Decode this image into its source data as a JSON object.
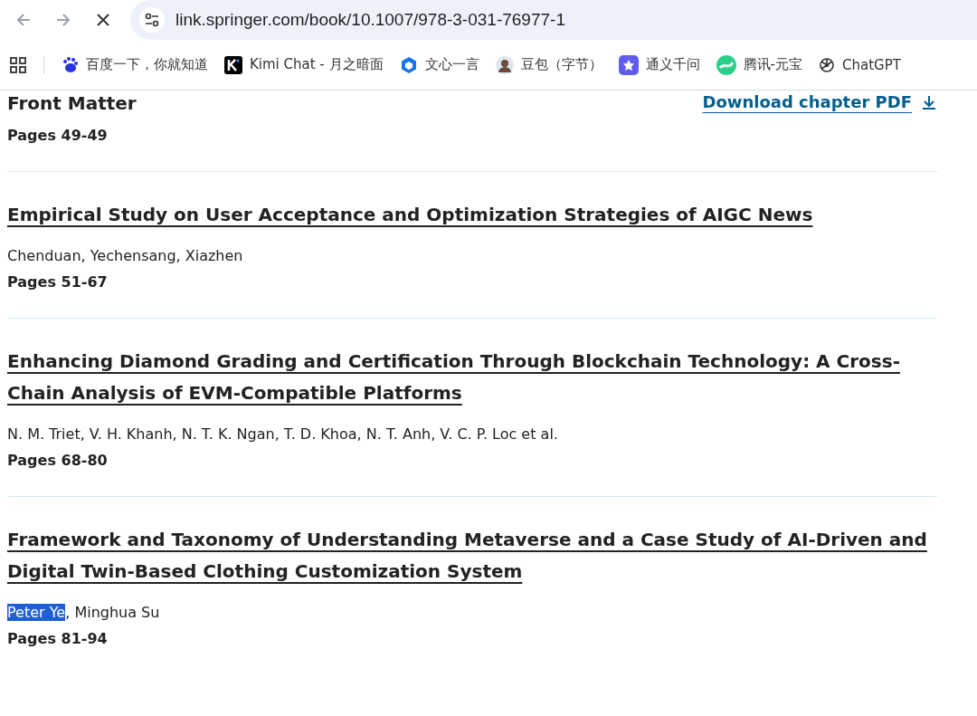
{
  "browser": {
    "url": "link.springer.com/book/10.1007/978-3-031-76977-1",
    "loading": true
  },
  "bookmarks": [
    {
      "label": "百度一下，你就知道"
    },
    {
      "label": "Kimi Chat - 月之暗面"
    },
    {
      "label": "文心一言"
    },
    {
      "label": "豆包（字节）"
    },
    {
      "label": "通义千问"
    },
    {
      "label": "腾讯-元宝"
    },
    {
      "label": "ChatGPT"
    }
  ],
  "front_matter": {
    "title": "Front Matter",
    "pages": "Pages 49-49",
    "download": "Download chapter PDF"
  },
  "chapters": [
    {
      "title": "Empirical Study on User Acceptance and Optimization Strategies of AIGC News",
      "authors": [
        {
          "text": "Chenduan, Yechensang, Xiazhen",
          "selected": false
        }
      ],
      "pages": "Pages 51-67"
    },
    {
      "title": "Enhancing Diamond Grading and Certification Through Blockchain Technology: A Cross-Chain Analysis of EVM-Compatible Platforms",
      "authors": [
        {
          "text": "N. M. Triet, V. H. Khanh, N. T. K. Ngan, T. D. Khoa, N. T. Anh, V. C. P. Loc et al.",
          "selected": false
        }
      ],
      "pages": "Pages 68-80"
    },
    {
      "title": "Framework and Taxonomy of Understanding Metaverse and a Case Study of AI-Driven and Digital Twin-Based Clothing Customization System",
      "authors": [
        {
          "text": "Peter Ye",
          "selected": true
        },
        {
          "text": ", Minghua Su",
          "selected": false
        }
      ],
      "pages": "Pages 81-94"
    }
  ]
}
